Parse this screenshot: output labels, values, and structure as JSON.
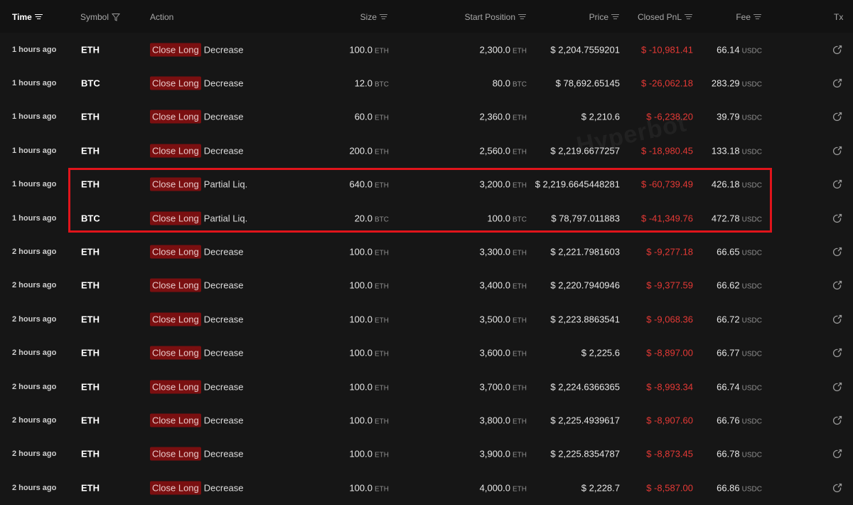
{
  "headers": {
    "time": "Time",
    "symbol": "Symbol",
    "action": "Action",
    "size": "Size",
    "start_position": "Start Position",
    "price": "Price",
    "closed_pnl": "Closed PnL",
    "fee": "Fee",
    "tx": "Tx"
  },
  "watermark": "Hyperbot",
  "colors": {
    "accent_red": "#e53935",
    "badge_bg": "#7a0f10",
    "highlight": "#e0141b"
  },
  "rows": [
    {
      "time": "1 hours ago",
      "symbol": "ETH",
      "badge": "Close Long",
      "action": "Decrease",
      "size": "100.0",
      "size_unit": "ETH",
      "start": "2,300.0",
      "start_unit": "ETH",
      "price": "$ 2,204.7559201",
      "pnl": "$ -10,981.41",
      "fee": "66.14",
      "fee_unit": "USDC"
    },
    {
      "time": "1 hours ago",
      "symbol": "BTC",
      "badge": "Close Long",
      "action": "Decrease",
      "size": "12.0",
      "size_unit": "BTC",
      "start": "80.0",
      "start_unit": "BTC",
      "price": "$ 78,692.65145",
      "pnl": "$ -26,062.18",
      "fee": "283.29",
      "fee_unit": "USDC"
    },
    {
      "time": "1 hours ago",
      "symbol": "ETH",
      "badge": "Close Long",
      "action": "Decrease",
      "size": "60.0",
      "size_unit": "ETH",
      "start": "2,360.0",
      "start_unit": "ETH",
      "price": "$ 2,210.6",
      "pnl": "$ -6,238.20",
      "fee": "39.79",
      "fee_unit": "USDC"
    },
    {
      "time": "1 hours ago",
      "symbol": "ETH",
      "badge": "Close Long",
      "action": "Decrease",
      "size": "200.0",
      "size_unit": "ETH",
      "start": "2,560.0",
      "start_unit": "ETH",
      "price": "$ 2,219.6677257",
      "pnl": "$ -18,980.45",
      "fee": "133.18",
      "fee_unit": "USDC"
    },
    {
      "time": "1 hours ago",
      "symbol": "ETH",
      "badge": "Close Long",
      "action": "Partial Liq.",
      "size": "640.0",
      "size_unit": "ETH",
      "start": "3,200.0",
      "start_unit": "ETH",
      "price": "$ 2,219.6645448281",
      "pnl": "$ -60,739.49",
      "fee": "426.18",
      "fee_unit": "USDC"
    },
    {
      "time": "1 hours ago",
      "symbol": "BTC",
      "badge": "Close Long",
      "action": "Partial Liq.",
      "size": "20.0",
      "size_unit": "BTC",
      "start": "100.0",
      "start_unit": "BTC",
      "price": "$ 78,797.011883",
      "pnl": "$ -41,349.76",
      "fee": "472.78",
      "fee_unit": "USDC"
    },
    {
      "time": "2 hours ago",
      "symbol": "ETH",
      "badge": "Close Long",
      "action": "Decrease",
      "size": "100.0",
      "size_unit": "ETH",
      "start": "3,300.0",
      "start_unit": "ETH",
      "price": "$ 2,221.7981603",
      "pnl": "$ -9,277.18",
      "fee": "66.65",
      "fee_unit": "USDC"
    },
    {
      "time": "2 hours ago",
      "symbol": "ETH",
      "badge": "Close Long",
      "action": "Decrease",
      "size": "100.0",
      "size_unit": "ETH",
      "start": "3,400.0",
      "start_unit": "ETH",
      "price": "$ 2,220.7940946",
      "pnl": "$ -9,377.59",
      "fee": "66.62",
      "fee_unit": "USDC"
    },
    {
      "time": "2 hours ago",
      "symbol": "ETH",
      "badge": "Close Long",
      "action": "Decrease",
      "size": "100.0",
      "size_unit": "ETH",
      "start": "3,500.0",
      "start_unit": "ETH",
      "price": "$ 2,223.8863541",
      "pnl": "$ -9,068.36",
      "fee": "66.72",
      "fee_unit": "USDC"
    },
    {
      "time": "2 hours ago",
      "symbol": "ETH",
      "badge": "Close Long",
      "action": "Decrease",
      "size": "100.0",
      "size_unit": "ETH",
      "start": "3,600.0",
      "start_unit": "ETH",
      "price": "$ 2,225.6",
      "pnl": "$ -8,897.00",
      "fee": "66.77",
      "fee_unit": "USDC"
    },
    {
      "time": "2 hours ago",
      "symbol": "ETH",
      "badge": "Close Long",
      "action": "Decrease",
      "size": "100.0",
      "size_unit": "ETH",
      "start": "3,700.0",
      "start_unit": "ETH",
      "price": "$ 2,224.6366365",
      "pnl": "$ -8,993.34",
      "fee": "66.74",
      "fee_unit": "USDC"
    },
    {
      "time": "2 hours ago",
      "symbol": "ETH",
      "badge": "Close Long",
      "action": "Decrease",
      "size": "100.0",
      "size_unit": "ETH",
      "start": "3,800.0",
      "start_unit": "ETH",
      "price": "$ 2,225.4939617",
      "pnl": "$ -8,907.60",
      "fee": "66.76",
      "fee_unit": "USDC"
    },
    {
      "time": "2 hours ago",
      "symbol": "ETH",
      "badge": "Close Long",
      "action": "Decrease",
      "size": "100.0",
      "size_unit": "ETH",
      "start": "3,900.0",
      "start_unit": "ETH",
      "price": "$ 2,225.8354787",
      "pnl": "$ -8,873.45",
      "fee": "66.78",
      "fee_unit": "USDC"
    },
    {
      "time": "2 hours ago",
      "symbol": "ETH",
      "badge": "Close Long",
      "action": "Decrease",
      "size": "100.0",
      "size_unit": "ETH",
      "start": "4,000.0",
      "start_unit": "ETH",
      "price": "$ 2,228.7",
      "pnl": "$ -8,587.00",
      "fee": "66.86",
      "fee_unit": "USDC"
    }
  ]
}
